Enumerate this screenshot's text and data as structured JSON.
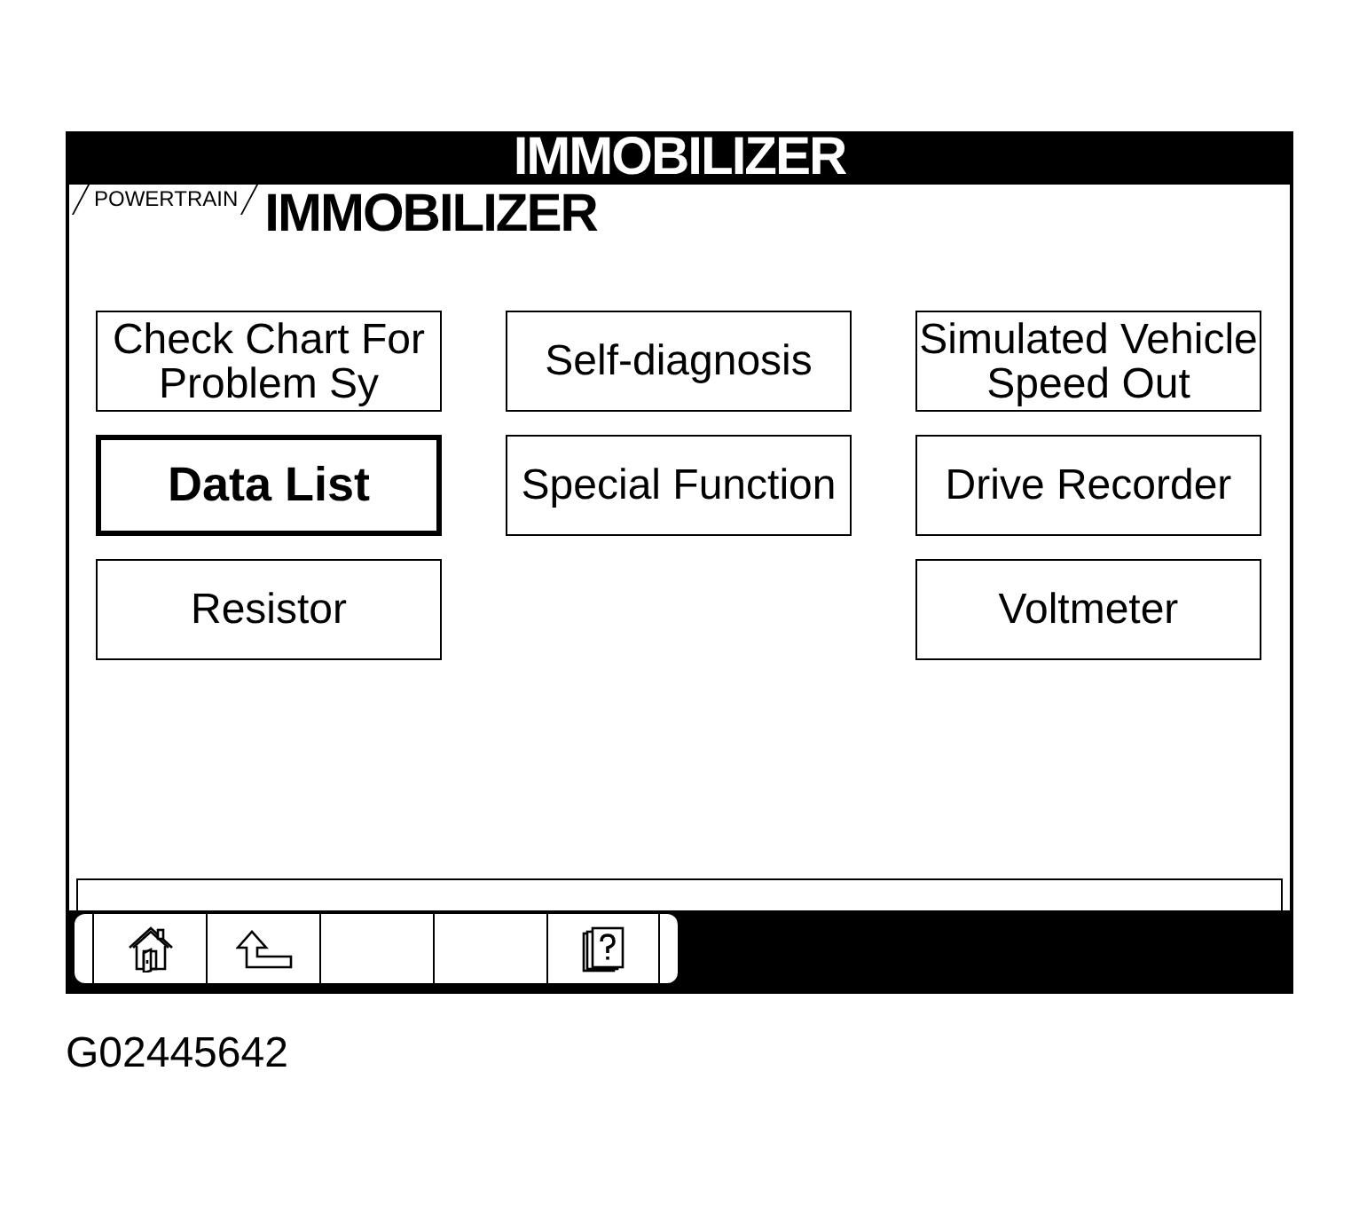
{
  "window": {
    "title": "IMMOBILIZER"
  },
  "breadcrumb": {
    "tag": "POWERTRAIN",
    "title": "IMMOBILIZER"
  },
  "menu_columns": [
    [
      {
        "label": "Check Chart For\nProblem Sy",
        "selected": false
      },
      {
        "label": "Data List",
        "selected": true
      },
      {
        "label": "Resistor",
        "selected": false
      }
    ],
    [
      {
        "label": "Self-diagnosis",
        "selected": false
      },
      {
        "label": "Special Function",
        "selected": false
      }
    ],
    [
      {
        "label": "Simulated Vehicle\nSpeed Out",
        "selected": false
      },
      {
        "label": "Drive Recorder",
        "selected": false
      },
      {
        "label": "Voltmeter",
        "selected": false
      }
    ]
  ],
  "toolbar": [
    {
      "kind": "home"
    },
    {
      "kind": "back"
    },
    {
      "kind": "blank"
    },
    {
      "kind": "blank"
    },
    {
      "kind": "help"
    }
  ],
  "caption": "G02445642"
}
